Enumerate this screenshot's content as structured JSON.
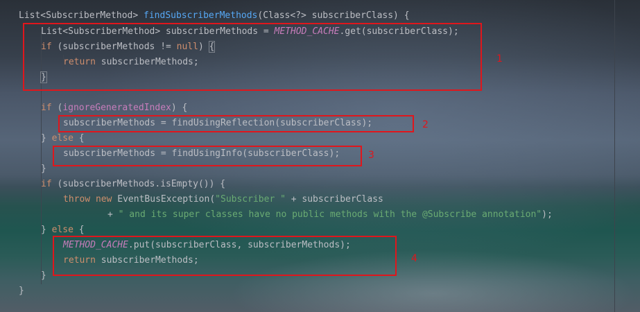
{
  "code": {
    "l01": {
      "a": "List<SubscriberMethod> ",
      "fn": "findSubscriberMethods",
      "b": "(Class<?> subscriberClass) {"
    },
    "l02": {
      "a": "List<SubscriberMethod> subscriberMethods = ",
      "c": "METHOD_CACHE",
      "b": ".get(subscriberClass);"
    },
    "l03": {
      "kw": "if",
      "a": " (subscriberMethods != ",
      "kw2": "null",
      ">": ") ",
      "brace": "{"
    },
    "l04": {
      "kw": "return",
      "a": " subscriberMethods;"
    },
    "l05": {
      "a": "}"
    },
    "l06": {
      "kw": "if",
      "a": " (",
      "c": "ignoreGeneratedIndex",
      "b": ") {"
    },
    "l07": {
      "a": "subscriberMethods = findUsingReflection(subscriberClass);"
    },
    "l08": {
      "a": "} ",
      "kw": "else",
      "b": " {"
    },
    "l09": {
      "a": "subscriberMethods = findUsingInfo(subscriberClass);"
    },
    "l10": {
      "a": "}"
    },
    "l11": {
      "kw": "if",
      "a": " (subscriberMethods.isEmpty()) {"
    },
    "l12": {
      "kw": "throw",
      "kw2": "new",
      "a": " EventBusException(",
      "s": "\"Subscriber \"",
      "b": " + subscriberClass"
    },
    "l13": {
      "a": "+ ",
      "s": "\" and its super classes have no public methods with the @Subscribe annotation\"",
      "b": ");"
    },
    "l14": {
      "a": "} ",
      "kw": "else",
      "b": " {"
    },
    "l15": {
      "c": "METHOD_CACHE",
      "a": ".put(subscriberClass, subscriberMethods);"
    },
    "l16": {
      "kw": "return",
      "a": " subscriberMethods;"
    },
    "l17": {
      "a": "}"
    },
    "l18": {
      "a": "}"
    }
  },
  "annotations": {
    "box1": "1",
    "box2": "2",
    "box3": "3",
    "box4": "4"
  },
  "colors": {
    "keyword": "#cf8e6d",
    "method": "#56a8f5",
    "constant": "#c77dbb",
    "string": "#6aab73",
    "annotation": "#e0161c"
  }
}
